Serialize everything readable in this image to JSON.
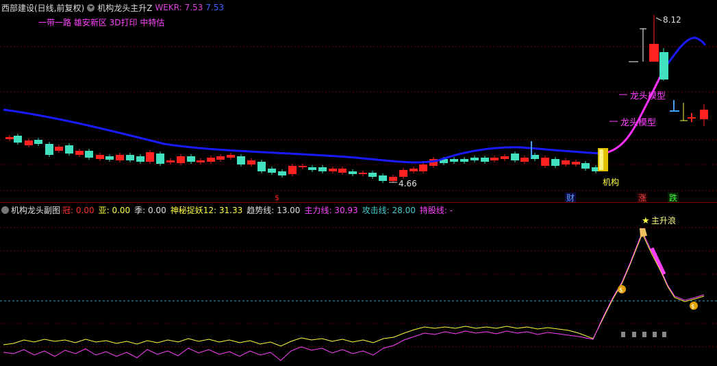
{
  "header": {
    "stock": "西部建设(日线,前复权)",
    "indicator": "机构龙头主升Z",
    "wekr_label": "WEKR: 7.53",
    "wekr_value": "7.53"
  },
  "concepts": "一带一路 雄安新区 3D打印 中特估",
  "annotations": {
    "high_price": "8.12",
    "low_price": "4.66",
    "dragon1": "龙头模型",
    "dragon2": "龙头模型",
    "institution": "机构",
    "marker_s": "$",
    "badge_cai": "财",
    "badge_zhang": "涨",
    "badge_die": "跌"
  },
  "sub": {
    "title": "机构龙头副图",
    "items": [
      {
        "label": "冠: 0.00",
        "color": "#ff3030"
      },
      {
        "label": "亚: 0.00",
        "color": "#ffff40"
      },
      {
        "label": "季: 0.00",
        "color": "#e0e0e0"
      },
      {
        "label": "神秘捉妖12: 31.33",
        "color": "#ffff40"
      },
      {
        "label": "趋势线: 13.00",
        "color": "#e0e0e0"
      },
      {
        "label": "主力线: 30.93",
        "color": "#ff40ff"
      },
      {
        "label": "攻击线: 28.00",
        "color": "#40d0d0"
      },
      {
        "label": "持股线: -",
        "color": "#ff40ff"
      }
    ],
    "main_rise": "主升浪"
  },
  "colors": {
    "up": "#ff2020",
    "down": "#40e0c0",
    "ma": "#1a1aff",
    "ma_hot": "#ff30ff"
  },
  "chart_data": {
    "type": "candlestick",
    "price_low": 4.66,
    "price_high": 8.12,
    "last_close": 7.53
  }
}
